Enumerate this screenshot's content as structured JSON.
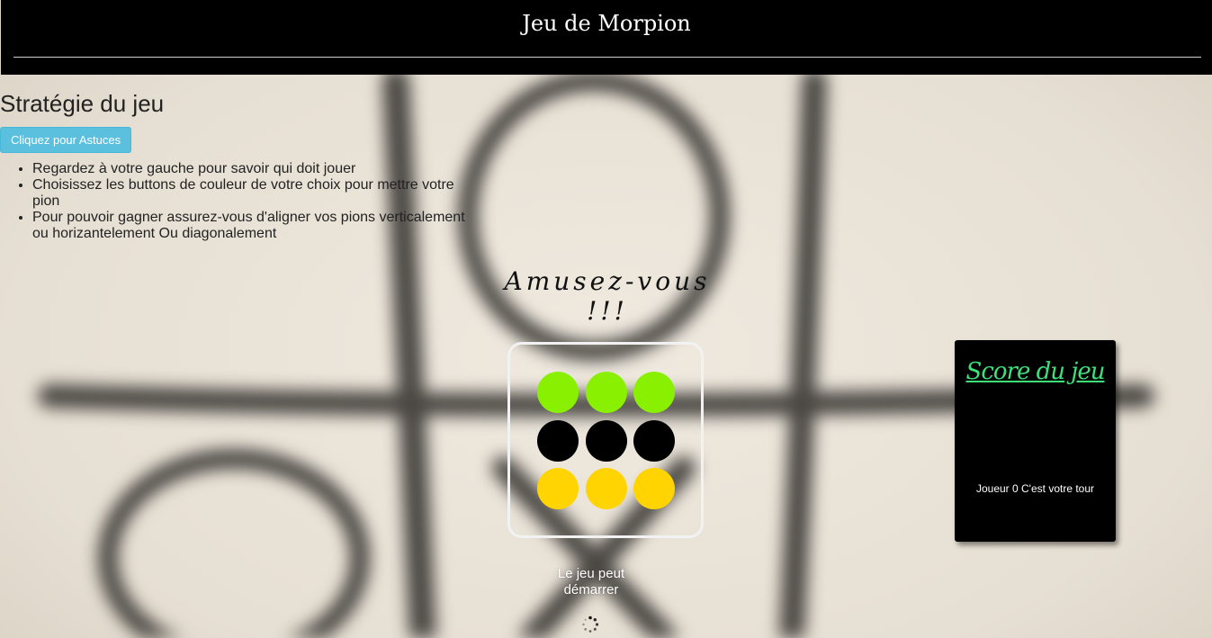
{
  "header": {
    "title": "Jeu de Morpion"
  },
  "strategy": {
    "heading": "Stratégie du jeu",
    "tips_button": "Cliquez pour Astuces",
    "items": [
      "Regardez à votre gauche pour savoir qui doit jouer",
      "Choisissez les buttons de couleur de votre choix pour mettre votre pion",
      "Pour pouvoir gagner assurez-vous d'aligner vos pions verticalement ou horizantelement Ou diagonalement"
    ]
  },
  "slogan": "Amusez-vous !!!",
  "board": {
    "rows": [
      [
        "#88f000",
        "#88f000",
        "#88f000"
      ],
      [
        "#000000",
        "#000000",
        "#000000"
      ],
      [
        "#ffd400",
        "#ffd400",
        "#ffd400"
      ]
    ]
  },
  "status": "Le jeu peut démarrer",
  "score": {
    "title": "Score du jeu",
    "turn_text": "Joueur 0 C'est votre tour"
  },
  "colors": {
    "header_bg": "#000000",
    "tips_button_bg": "#5bc0de",
    "score_title": "#3ee07a"
  }
}
